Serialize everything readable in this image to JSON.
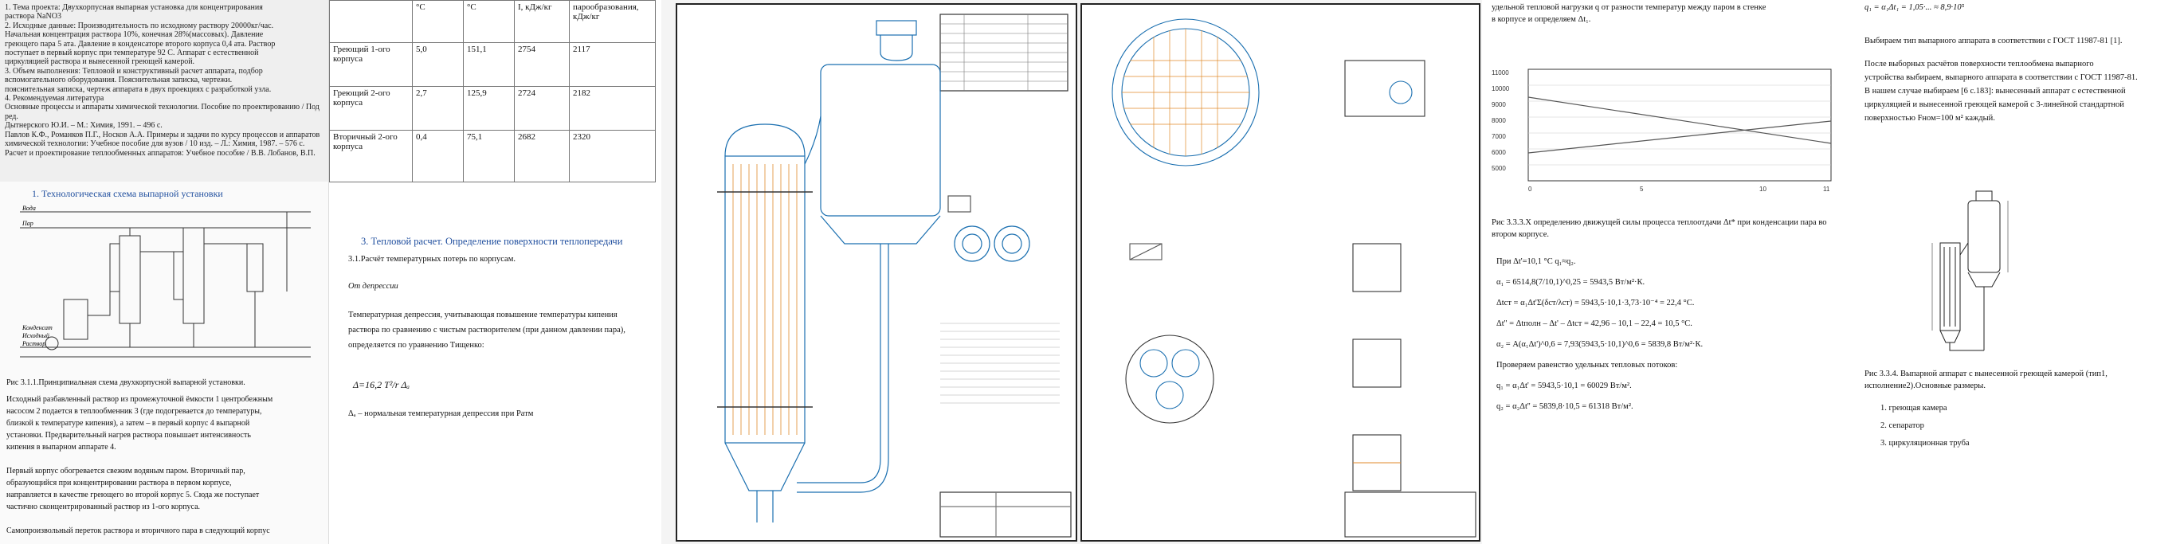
{
  "panel1": {
    "scan_lines": [
      "1. Тема проекта: Двухкорпусная выпарная установка для концентрирования",
      "раствора NaNO3",
      "2. Исходные данные: Производительность по исходному раствору 20000кг/час.",
      "Начальная концентрация раствора 10%, конечная 28%(массовых). Давление",
      "греющего пара 5 ата. Давление в конденсаторе второго корпуса 0,4 ата. Раствор",
      "поступает в первый корпус при температуре 92 С. Аппарат с естественной",
      "циркуляцией раствора и вынесенной греющей камерой.",
      "3. Объем выполнения: Тепловой и конструктивный расчет аппарата, подбор",
      "вспомогательного оборудования. Пояснительная записка, чертежи.",
      "пояснительная записка, чертеж аппарата в двух проекциях с разработкой узла.",
      "4. Рекомендуемая литература",
      "Основные процессы и аппараты химической технологии. Пособие по проектированию / Под ред.",
      "Дытнерского Ю.И. – М.: Химия, 1991. – 496 с.",
      "Павлов К.Ф., Романков П.Г., Носков А.А. Примеры и задачи по курсу процессов и аппаратов",
      "химической технологии: Учебное пособие для вузов / 10 изд. – Л.: Химия, 1987. – 576 с.",
      "Расчет и проектирование теплообменных аппаратов: Учебное пособие / В.В. Лобанов, В.П."
    ],
    "section_title": "1. Технологическая схема выпарной установки",
    "scheme_labels": [
      "Вода",
      "Пар",
      "Конденсат",
      "Исходный",
      "Раствор"
    ],
    "figure_caption": "Рис 3.1.1.Принципиальная схема двухкорпусной выпарной установки.",
    "body_lines": [
      "Исходный разбавленный раствор из промежуточной ёмкости 1 центробежным",
      "насосом 2 подается в теплообменник 3 (где подогревается до температуры,",
      "близкой к температуре кипения), а затем – в первый корпус 4 выпарной",
      "установки. Предварительный нагрев раствора повышает интенсивность",
      "кипения в выпарном аппарате 4.",
      "",
      "Первый корпус обогревается свежим водяным паром. Вторичный пар,",
      "образующийся при концентрировании раствора в первом корпусе,",
      "направляется в качестве греющего во второй корпус 5. Сюда же поступает",
      "частично сконцентрированный раствор из 1-ого корпуса.",
      "",
      "Самопроизвольный переток раствора и вторичного пара в следующий корпус"
    ]
  },
  "panel2": {
    "table_header": [
      "",
      "°С",
      "I, кДж/кг",
      "парообразования, кДж/кг"
    ],
    "table_rows": [
      [
        "Греющий 1-ого корпуса",
        "5,0",
        "151,1",
        "2754",
        "2117"
      ],
      [
        "Греющий 2-ого корпуса",
        "2,7",
        "125,9",
        "2724",
        "2182"
      ],
      [
        "Вторичный 2-ого корпуса",
        "0,4",
        "75,1",
        "2682",
        "2320"
      ]
    ],
    "heading": "3. Тепловой расчет. Определение поверхности теплопередачи",
    "subheading": "3.1.Расчёт температурных потерь по корпусам.",
    "italic_label": "От депрессии",
    "para": [
      "Температурная депрессия, учитывающая повышение температуры кипения",
      "раствора по сравнению с чистым растворителем (при данном давлении пара),",
      "определяется по уравнению Тищенко:"
    ],
    "formula": "Δ=16,2 T²/r Δₐ",
    "note": "Δₐ – нормальная температурная депрессия при Pатм"
  },
  "panel4": {
    "top_lines": [
      "удельной тепловой нагрузки q от разности температур между паром в стенке",
      "в корпусе и определяем Δt₁."
    ],
    "chart_ticks_y": [
      "11000",
      "10000",
      "9000",
      "8000",
      "7000",
      "6000",
      "5000"
    ],
    "chart_ticks_x": [
      "0",
      "5",
      "10",
      "11"
    ],
    "sub_heading": "Рис 3.3.3.Х определению движущей силы процесса теплоотдачи Δt* при конденсации пара во втором корпусе.",
    "calc_lines": [
      "При Δt'=10,1 °С q₁≈q₂.",
      "α₁ = 6514,8(7/10,1)^0,25 = 5943,5 Вт/м²·К.",
      "Δtст = α₁Δt'Σ(δст/λст) = 5943,5·10,1·3,73·10⁻⁴ = 22,4 °С.",
      "Δt'' = Δtполн – Δt' – Δtст = 42,96 – 10,1 – 22,4 = 10,5 °С.",
      "α₂ = A(α₁Δt')^0,6 = 7,93(5943,5·10,1)^0,6 = 5839,8 Вт/м²·К.",
      "Проверяем равенство удельных тепловых потоков:",
      "q₁ = α₁Δt' = 5943,5·10,1 = 60029 Вт/м².",
      "q₂ = α₂Δt'' = 5839,8·10,5 = 61318 Вт/м²."
    ],
    "right_top": "Выбираем тип выпарного аппарата в соответствии с ГОСТ 11987-81 [1].",
    "right_para": [
      "После выборных расчётов поверхности теплообмена выпарного",
      "устройства выбираем, выпарного аппарата в соответствии с ГОСТ 11987-81.",
      "В нашем случае выбираем [6 с.183]: вынесенный аппарат с естественной",
      "циркуляцией и вынесенной греющей камерой с 3-линейной стандартной",
      "поверхностью Fном=100 м² каждый."
    ],
    "right_caption": "Рис 3.3.4. Выпарной аппарат с вынесенной греющей камерой (тип1, исполнение2).Основные размеры.",
    "right_list": [
      "1. греющая камера",
      "2. сепаратор",
      "3. циркуляционная труба"
    ],
    "formula_top": "q₁ = α₁Δt₁ = 1,05·... ≈ 8,9·10⁵"
  },
  "colors": {
    "accent_blue": "#1a6fb0",
    "drawing_orange": "#e08a2a",
    "heading_blue": "#1f4e9e"
  }
}
